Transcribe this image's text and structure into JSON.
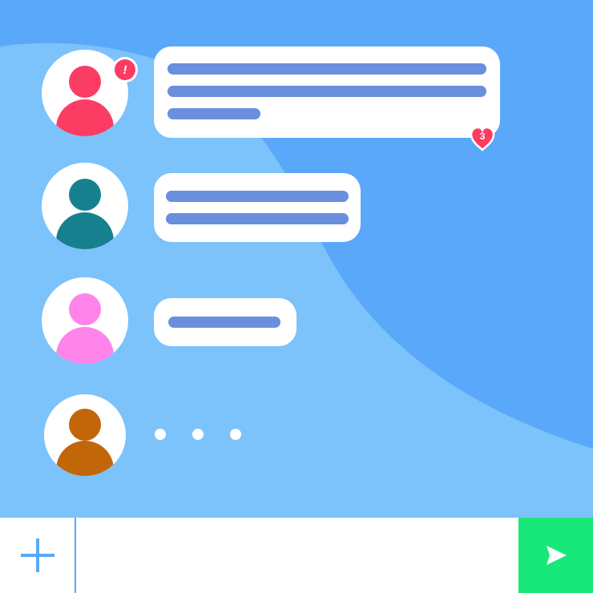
{
  "colors": {
    "bg_dark": "#5aa8fa",
    "bg_light": "#7cc2fb",
    "bubble": "#ffffff",
    "line": "#6a8fdc",
    "alert": "#fb3d63",
    "accent": "#5aa8fa",
    "send": "#18e87a"
  },
  "messages": [
    {
      "avatar_head": "#fb3d63",
      "avatar_body": "#fb3d63",
      "alert_badge": "!",
      "reaction": {
        "icon": "heart-icon",
        "count": "3"
      },
      "lines": 3
    },
    {
      "avatar_head": "#17808f",
      "avatar_body": "#17808f",
      "lines": 2
    },
    {
      "avatar_head": "#ff84ea",
      "avatar_body": "#ff84ea",
      "lines": 1
    },
    {
      "avatar_head": "#c1670a",
      "avatar_body": "#c1670a",
      "typing": true
    }
  ],
  "composer": {
    "add_icon": "plus-icon",
    "placeholder": "",
    "value": "",
    "send_icon": "send-arrow-icon"
  }
}
